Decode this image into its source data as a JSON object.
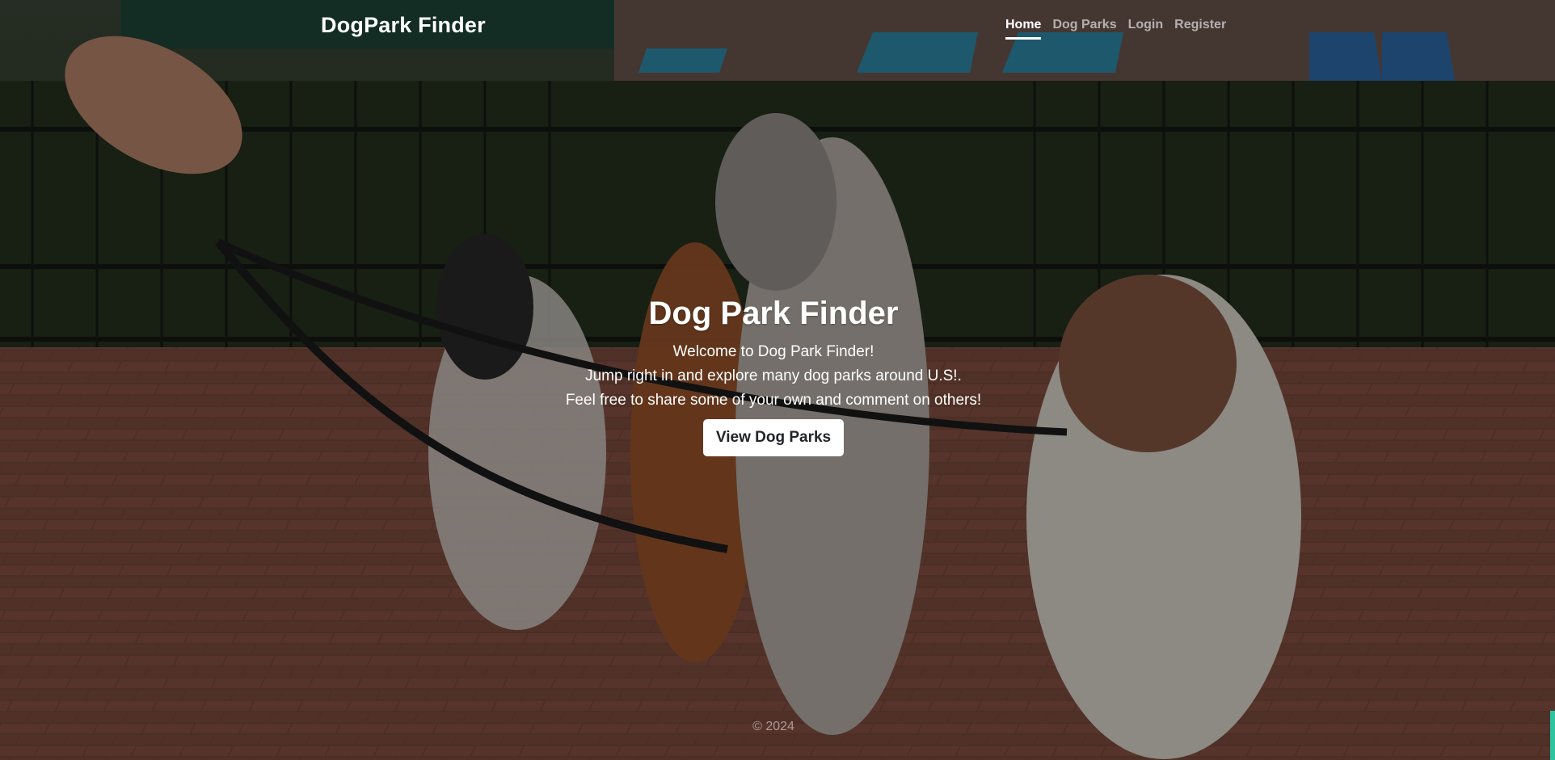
{
  "navbar": {
    "brand": "DogPark Finder",
    "links": [
      {
        "label": "Home",
        "active": true
      },
      {
        "label": "Dog Parks",
        "active": false
      },
      {
        "label": "Login",
        "active": false
      },
      {
        "label": "Register",
        "active": false
      }
    ]
  },
  "hero": {
    "title": "Dog Park Finder",
    "lines": [
      "Welcome to Dog Park Finder!",
      "Jump right in and explore many dog parks around U.S!.",
      "Feel free to share some of your own and comment on others!"
    ],
    "cta_label": "View Dog Parks",
    "background_image": "dogs-in-park-photo"
  },
  "footer": {
    "copyright": "© 2024"
  },
  "colors": {
    "overlay": "#000000",
    "text": "#ffffff",
    "button_bg": "#ffffff",
    "button_text": "#212529",
    "brick": "#7a4a3c",
    "scroll_thumb": "#2ec4a0"
  }
}
